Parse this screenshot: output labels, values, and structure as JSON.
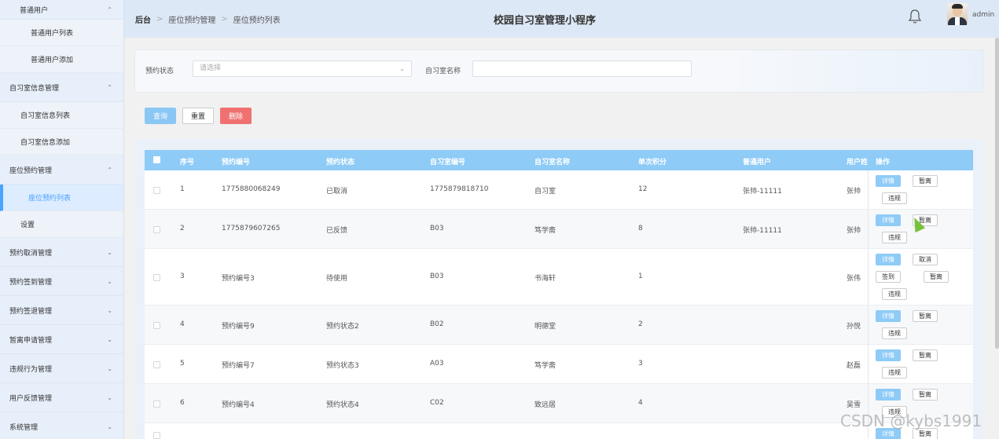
{
  "sidebar": {
    "groups": [
      {
        "label": "普通用户",
        "expanded": true,
        "items": [
          "普通用户列表",
          "普通用户添加"
        ]
      },
      {
        "label": "自习室信息管理",
        "expanded": true,
        "items": [
          "自习室信息列表",
          "自习室信息添加"
        ]
      },
      {
        "label": "座位预约管理",
        "expanded": true,
        "items": [
          "座位预约列表",
          "设置"
        ]
      },
      {
        "label": "预约取消管理",
        "expanded": false,
        "items": []
      },
      {
        "label": "预约签到管理",
        "expanded": false,
        "items": []
      },
      {
        "label": "预约签退管理",
        "expanded": false,
        "items": []
      },
      {
        "label": "暂离申请管理",
        "expanded": false,
        "items": []
      },
      {
        "label": "违规行为管理",
        "expanded": false,
        "items": []
      },
      {
        "label": "用户反馈管理",
        "expanded": false,
        "items": []
      },
      {
        "label": "系统管理",
        "expanded": false,
        "items": []
      }
    ],
    "active_item": "座位预约列表",
    "chevron_up": "⌃",
    "chevron_down": "⌄"
  },
  "header": {
    "breadcrumb": [
      "后台",
      "座位预约管理",
      "座位预约列表"
    ],
    "title": "校园自习室管理小程序",
    "user": "admin"
  },
  "search": {
    "status_label": "预约状态",
    "status_placeholder": "请选择",
    "room_name_label": "自习室名称",
    "room_name_value": ""
  },
  "buttons": {
    "query": "查询",
    "reset": "重置",
    "delete": "删除"
  },
  "table": {
    "columns": [
      "序号",
      "预约编号",
      "预约状态",
      "自习室编号",
      "自习室名称",
      "单次积分",
      "普通用户",
      "用户姓",
      "操作"
    ],
    "rows": [
      {
        "idx": "1",
        "code": "1775880068249",
        "status": "已取消",
        "room_code": "1775879818710",
        "room_name": "自习室",
        "points": "12",
        "user": "张帅-11111",
        "name": "张帅",
        "ops": [
          "详情",
          "暂离",
          "违规"
        ]
      },
      {
        "idx": "2",
        "code": "1775879607265",
        "status": "已反馈",
        "room_code": "B03",
        "room_name": "笃学斋",
        "points": "8",
        "user": "张帅-11111",
        "name": "张帅",
        "ops": [
          "详情",
          "暂离",
          "违规"
        ]
      },
      {
        "idx": "3",
        "code": "预约编号3",
        "status": "待使用",
        "room_code": "B03",
        "room_name": "书海轩",
        "points": "1",
        "user": "",
        "name": "张伟",
        "ops": [
          "详情",
          "取消",
          "签到",
          "暂离",
          "违规"
        ]
      },
      {
        "idx": "4",
        "code": "预约编号9",
        "status": "预约状态2",
        "room_code": "B02",
        "room_name": "明德堂",
        "points": "2",
        "user": "",
        "name": "孙悦",
        "ops": [
          "详情",
          "暂离",
          "违规"
        ]
      },
      {
        "idx": "5",
        "code": "预约编号7",
        "status": "预约状态3",
        "room_code": "A03",
        "room_name": "笃学斋",
        "points": "3",
        "user": "",
        "name": "赵磊",
        "ops": [
          "详情",
          "暂离",
          "违规"
        ]
      },
      {
        "idx": "6",
        "code": "预约编号4",
        "status": "预约状态4",
        "room_code": "C02",
        "room_name": "致远居",
        "points": "4",
        "user": "",
        "name": "吴雪",
        "ops": [
          "详情",
          "暂离",
          "违规"
        ]
      },
      {
        "idx": "",
        "code": "",
        "status": "",
        "room_code": "",
        "room_name": "",
        "points": "",
        "user": "",
        "name": "",
        "ops": [
          "详情",
          "暂离"
        ]
      }
    ]
  },
  "watermark": "CSDN @kybs1991"
}
